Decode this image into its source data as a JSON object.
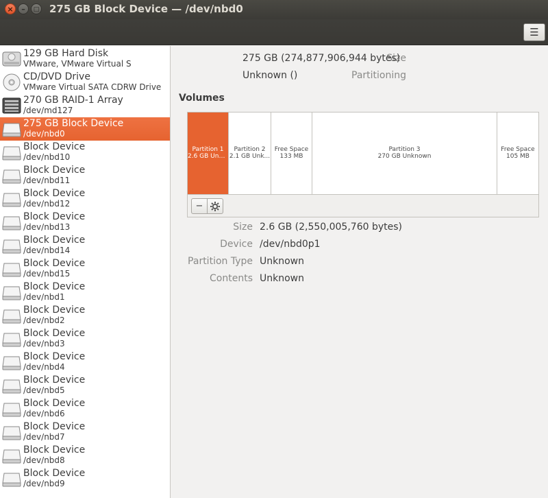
{
  "window": {
    "title": "275 GB Block Device — /dev/nbd0",
    "close_glyph": "×",
    "minimize_glyph": "–",
    "maximize_glyph": "□"
  },
  "header": {
    "menu_glyph": "☰"
  },
  "sidebar": {
    "items": [
      {
        "name": "129 GB Hard Disk",
        "sub": "VMware, VMware Virtual S",
        "icon": "hard-disk-icon"
      },
      {
        "name": "CD/DVD Drive",
        "sub": "VMware Virtual SATA CDRW Drive",
        "icon": "optical-drive-icon"
      },
      {
        "name": "270 GB RAID-1 Array",
        "sub": "/dev/md127",
        "icon": "raid-array-icon"
      },
      {
        "name": "275 GB Block Device",
        "sub": "/dev/nbd0",
        "icon": "block-device-icon",
        "selected": true
      },
      {
        "name": "Block Device",
        "sub": "/dev/nbd10",
        "icon": "block-device-icon"
      },
      {
        "name": "Block Device",
        "sub": "/dev/nbd11",
        "icon": "block-device-icon"
      },
      {
        "name": "Block Device",
        "sub": "/dev/nbd12",
        "icon": "block-device-icon"
      },
      {
        "name": "Block Device",
        "sub": "/dev/nbd13",
        "icon": "block-device-icon"
      },
      {
        "name": "Block Device",
        "sub": "/dev/nbd14",
        "icon": "block-device-icon"
      },
      {
        "name": "Block Device",
        "sub": "/dev/nbd15",
        "icon": "block-device-icon"
      },
      {
        "name": "Block Device",
        "sub": "/dev/nbd1",
        "icon": "block-device-icon"
      },
      {
        "name": "Block Device",
        "sub": "/dev/nbd2",
        "icon": "block-device-icon"
      },
      {
        "name": "Block Device",
        "sub": "/dev/nbd3",
        "icon": "block-device-icon"
      },
      {
        "name": "Block Device",
        "sub": "/dev/nbd4",
        "icon": "block-device-icon"
      },
      {
        "name": "Block Device",
        "sub": "/dev/nbd5",
        "icon": "block-device-icon"
      },
      {
        "name": "Block Device",
        "sub": "/dev/nbd6",
        "icon": "block-device-icon"
      },
      {
        "name": "Block Device",
        "sub": "/dev/nbd7",
        "icon": "block-device-icon"
      },
      {
        "name": "Block Device",
        "sub": "/dev/nbd8",
        "icon": "block-device-icon"
      },
      {
        "name": "Block Device",
        "sub": "/dev/nbd9",
        "icon": "block-device-icon"
      }
    ]
  },
  "disk": {
    "size_label": "Size",
    "size_value": "275 GB (274,877,906,944 bytes)",
    "partitioning_label": "Partitioning",
    "partitioning_value": "Unknown ()"
  },
  "volumes": {
    "title": "Volumes",
    "segments": [
      {
        "line1": "Partition 1",
        "line2": "2.6 GB Unk...",
        "selected": true
      },
      {
        "line1": "Partition 2",
        "line2": "2.1 GB Unk..."
      },
      {
        "line1": "Free Space",
        "line2": "133 MB"
      },
      {
        "line1": "Partition 3",
        "line2": "270 GB Unknown"
      },
      {
        "line1": "Free Space",
        "line2": "105 MB"
      }
    ],
    "toolbar": {
      "minus_glyph": "−",
      "gear_icon": "gear-icon"
    }
  },
  "partition": {
    "size_label": "Size",
    "size_value": "2.6 GB (2,550,005,760 bytes)",
    "device_label": "Device",
    "device_value": "/dev/nbd0p1",
    "type_label": "Partition Type",
    "type_value": "Unknown",
    "contents_label": "Contents",
    "contents_value": "Unknown"
  },
  "colors": {
    "accent": "#e66330",
    "titlebar": "#3c3b37"
  }
}
